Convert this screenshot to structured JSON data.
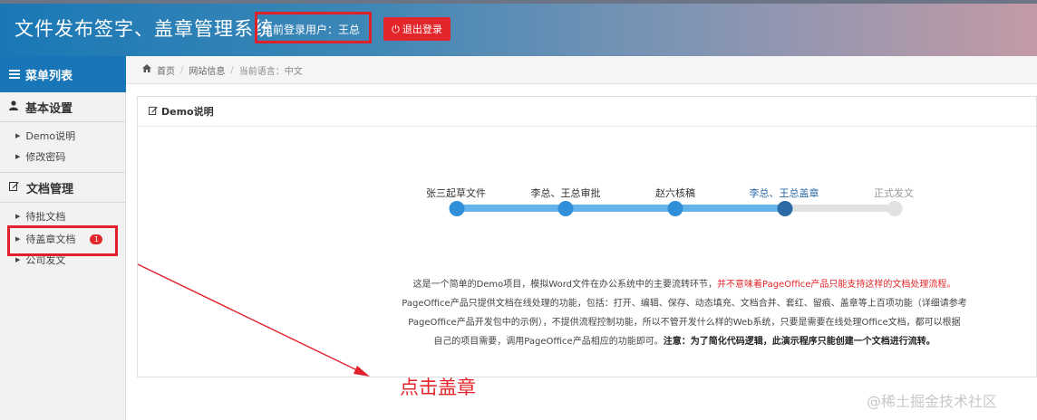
{
  "header": {
    "app_title": "文件发布签字、盖章管理系统",
    "current_user": "当前登录用户：王总",
    "logout_label": "退出登录",
    "logout_icon": "power-icon"
  },
  "sidebar": {
    "menu_title": "菜单列表",
    "sections": [
      {
        "title": "基本设置",
        "icon": "user-icon",
        "items": [
          {
            "label": "Demo说明"
          },
          {
            "label": "修改密码"
          }
        ]
      },
      {
        "title": "文档管理",
        "icon": "edit-icon",
        "items": [
          {
            "label": "待批文档"
          },
          {
            "label": "待盖章文档",
            "badge": "1"
          },
          {
            "label": "公司发文"
          }
        ]
      }
    ]
  },
  "breadcrumb": {
    "home": "首页",
    "site_info": "网站信息",
    "language": "当前语言：中文"
  },
  "panel": {
    "title": "Demo说明",
    "steps": [
      {
        "label": "张三起草文件",
        "status": "done"
      },
      {
        "label": "李总、王总审批",
        "status": "done"
      },
      {
        "label": "赵六核稿",
        "status": "done"
      },
      {
        "label": "李总、王总盖章",
        "status": "current"
      },
      {
        "label": "正式发文",
        "status": "pending"
      }
    ],
    "description": {
      "p1": "这是一个简单的Demo项目，模拟Word文件在办公系统中的主要流转环节，",
      "p1_red": "并不意味着PageOffice产品只能支持这样的文档处理流程。",
      "p2": "PageOffice产品只提供文档在线处理的功能，包括：打开、编辑、保存、动态填充、文档合并、套红、留痕、盖章等上百项功能（详细请参考",
      "p3": "PageOffice产品开发包中的示例），不提供流程控制功能，所以不管开发什么样的Web系统，只要是需要在线处理Office文档，都可以根据",
      "p4": "自己的项目需要，调用PageOffice产品相应的功能即可。",
      "p4_bold": "注意：为了简化代码逻辑，此演示程序只能创建一个文档进行流转。"
    }
  },
  "annotation": {
    "text": "点击盖章"
  },
  "watermark": "@稀土掘金技术社区",
  "colors": {
    "accent": "#1875b8",
    "step_done": "#2f8fd8",
    "step_current": "#2a6aa6",
    "step_pending": "#e1e1e1",
    "annotation_red": "#e0202a"
  }
}
